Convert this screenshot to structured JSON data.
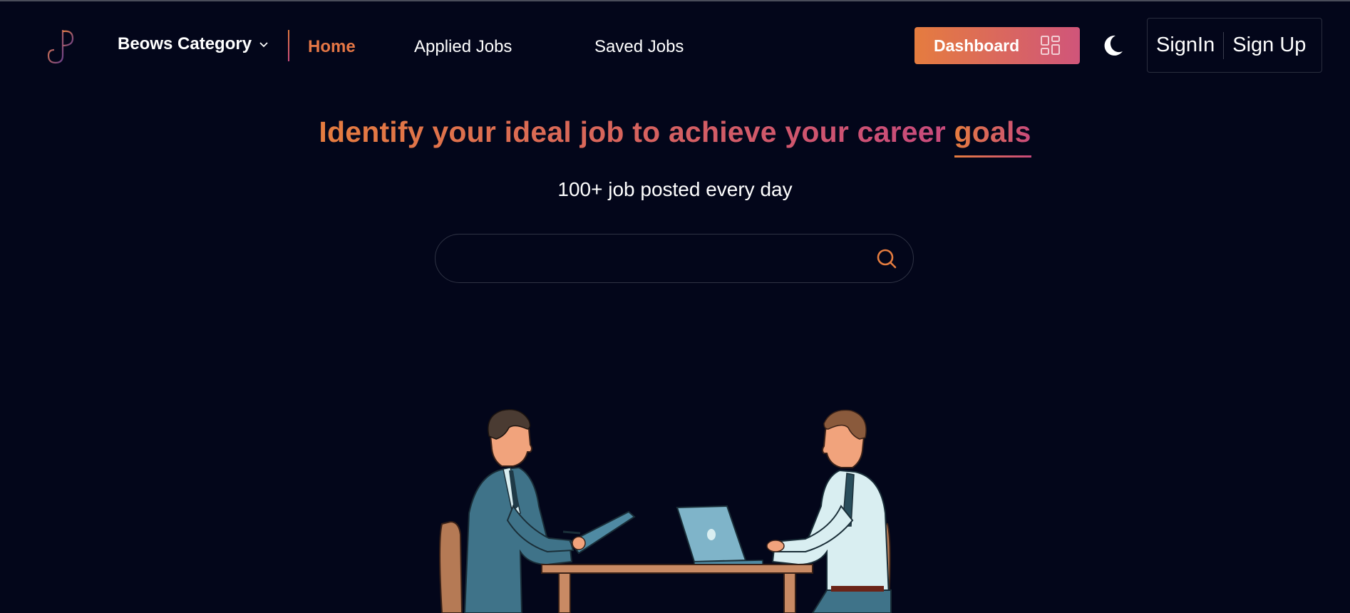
{
  "header": {
    "logo_icon": "jp-monogram-logo",
    "category_label": "Beows Category",
    "nav": [
      {
        "label": "Home",
        "active": true
      },
      {
        "label": "Applied Jobs",
        "active": false
      },
      {
        "label": "Saved Jobs",
        "active": false
      }
    ],
    "dashboard_label": "Dashboard",
    "dashboard_icon": "grid-icon",
    "theme_icon": "moon-icon",
    "signin_label": "SignIn",
    "signup_label": "Sign Up"
  },
  "hero": {
    "headline_main": "Identify your ideal job to achieve your career",
    "headline_highlight": "goals",
    "subtitle": "100+ job posted every day",
    "search": {
      "value": "",
      "placeholder": ""
    },
    "search_icon": "search-icon",
    "illustration": "two businessmen interview at desk"
  },
  "colors": {
    "background": "#03061a",
    "accent_orange": "#e57c3f",
    "accent_pink": "#c84a7c",
    "text": "#ffffff"
  }
}
